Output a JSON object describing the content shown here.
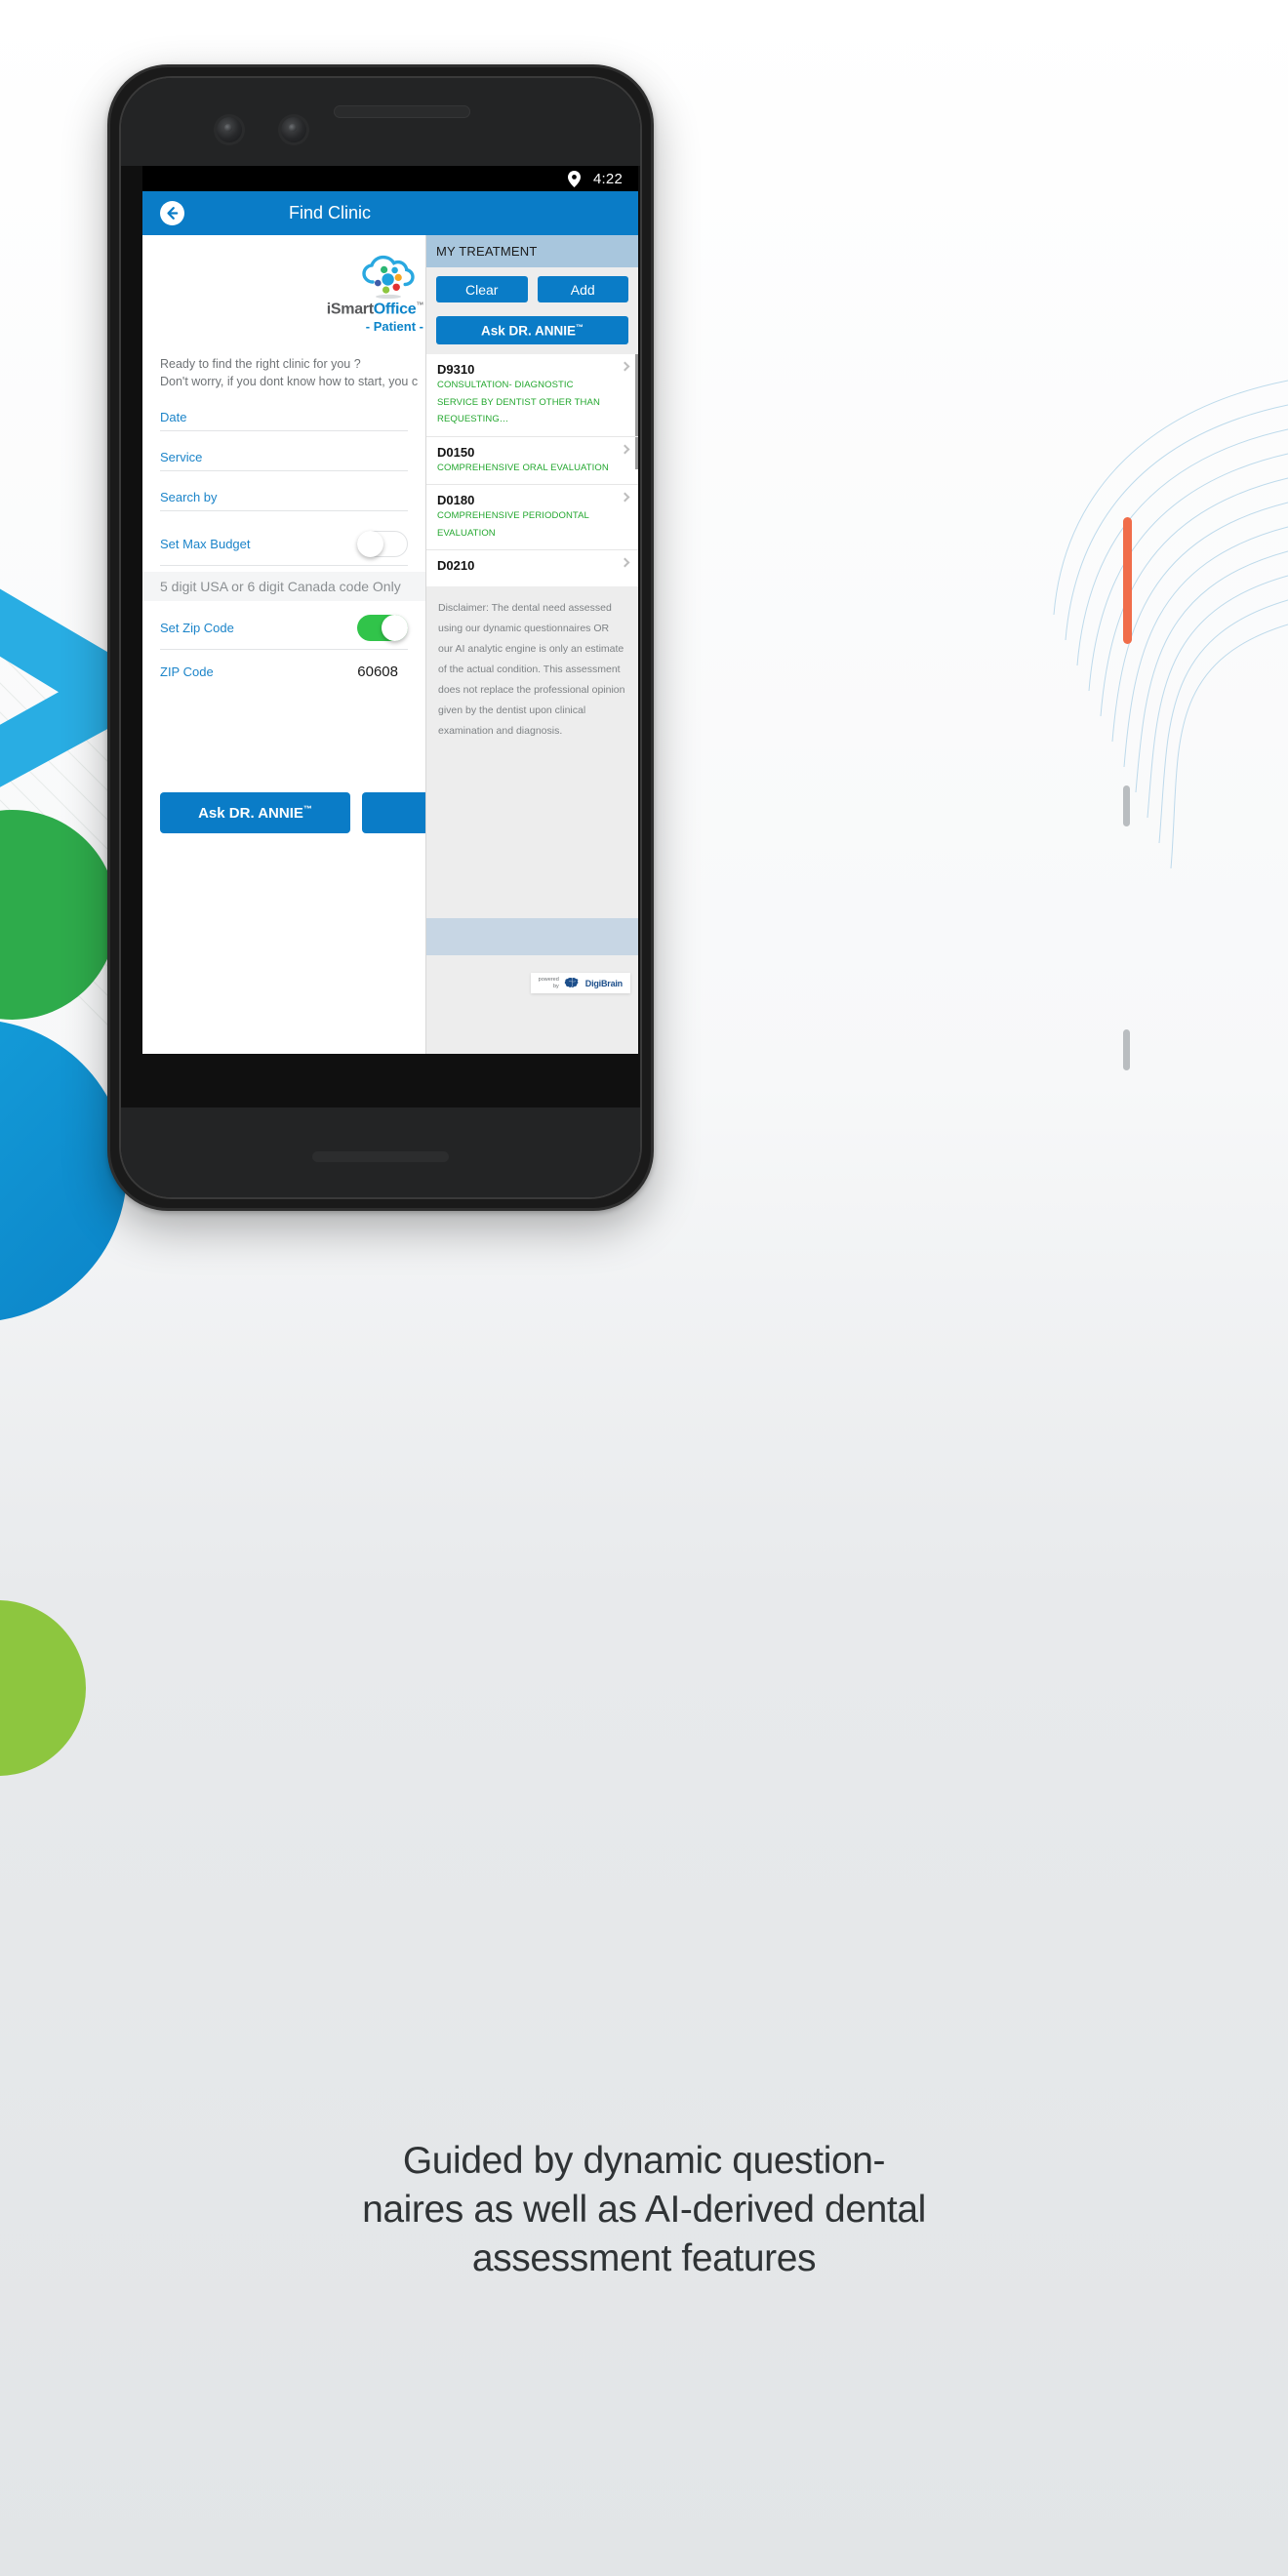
{
  "caption": "Guided by dynamic question-\nnaires as well as AI-derived dental\nassessment features",
  "colors": {
    "brand_blue": "#0a7cc7",
    "link_blue": "#1b84c9",
    "green": "#23a72f",
    "toggle_green": "#31c44a",
    "panel_header": "#a8c6dd",
    "panel_bg": "#ededed"
  },
  "statusbar": {
    "time": "4:22",
    "location_icon": "location-pin-icon"
  },
  "appbar": {
    "back_icon": "back-arrow-icon",
    "title": "Find Clinic"
  },
  "logo": {
    "mark": "cloud-dots-logo",
    "word_gray": "iSmart",
    "word_blue": "Office",
    "trademark": "™",
    "subtitle": "- Patient -"
  },
  "intro": {
    "line1": "Ready to find the right clinic for you ?",
    "line2": "Don't worry, if you dont know how to start, you c"
  },
  "form": {
    "fields": [
      {
        "label": "Date",
        "value": ""
      },
      {
        "label": "Service",
        "value": ""
      },
      {
        "label": "Search by",
        "value": ""
      }
    ],
    "max_budget": {
      "label": "Set Max Budget",
      "state": "off"
    },
    "zip_hint": "5 digit USA or 6 digit Canada code Only",
    "set_zip": {
      "label": "Set Zip Code",
      "state": "on"
    },
    "zip_code": {
      "label": "ZIP Code",
      "value": "60608"
    }
  },
  "cta": {
    "primary": "Ask DR. ANNIE",
    "primary_tm": "™",
    "secondary": ""
  },
  "treatment_panel": {
    "header": "MY TREATMENT",
    "clear_label": "Clear",
    "add_label": "Add",
    "ask_label": "Ask DR. ANNIE",
    "ask_tm": "™",
    "codes": [
      {
        "id": "D9310",
        "desc": "CONSULTATION- DIAGNOSTIC SERVICE BY DENTIST OTHER THAN REQUESTING…"
      },
      {
        "id": "D0150",
        "desc": "COMPREHENSIVE ORAL EVALUATION"
      },
      {
        "id": "D0180",
        "desc": "COMPREHENSIVE PERIODONTAL EVALUATION"
      },
      {
        "id": "D0210",
        "desc": ""
      }
    ],
    "disclaimer": "Disclaimer: The dental need assessed using our dynamic questionnaires OR our AI analytic engine is only an estimate of the actual condition. This assessment does not replace the professional opinion given by the dentist upon clinical examination and diagnosis.",
    "powered_line1": "powered",
    "powered_line2": "by",
    "powered_brand": "DigiBrain"
  }
}
